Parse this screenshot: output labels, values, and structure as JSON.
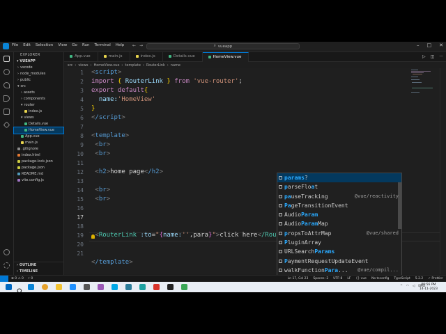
{
  "titlebar": {
    "menu": [
      "File",
      "Edit",
      "Selection",
      "View",
      "Go",
      "Run",
      "Terminal",
      "Help"
    ],
    "command_center": "vueapp"
  },
  "sidebar": {
    "header": "EXPLORER",
    "project": "VUEAPP",
    "items": [
      {
        "label": "vscode",
        "indent": 1,
        "icon_color": "#c5c5c5",
        "kind": "folder"
      },
      {
        "label": "node_modules",
        "indent": 1,
        "icon_color": "#c5c5c5",
        "kind": "folder"
      },
      {
        "label": "public",
        "indent": 1,
        "icon_color": "#c5c5c5",
        "kind": "folder"
      },
      {
        "label": "src",
        "indent": 1,
        "icon_color": "#c5c5c5",
        "kind": "folder-open"
      },
      {
        "label": "assets",
        "indent": 2,
        "icon_color": "#c5c5c5",
        "kind": "folder"
      },
      {
        "label": "components",
        "indent": 2,
        "icon_color": "#c5c5c5",
        "kind": "folder"
      },
      {
        "label": "router",
        "indent": 2,
        "icon_color": "#c5c5c5",
        "kind": "folder-open"
      },
      {
        "label": "index.js",
        "indent": 3,
        "icon_color": "#e8d44d",
        "kind": "file"
      },
      {
        "label": "views",
        "indent": 2,
        "icon_color": "#c5c5c5",
        "kind": "folder-open"
      },
      {
        "label": "Details.vue",
        "indent": 3,
        "icon_color": "#41b883",
        "kind": "file"
      },
      {
        "label": "HomeView.vue",
        "indent": 3,
        "icon_color": "#41b883",
        "kind": "file",
        "selected": true
      },
      {
        "label": "App.vue",
        "indent": 2,
        "icon_color": "#41b883",
        "kind": "file"
      },
      {
        "label": "main.js",
        "indent": 2,
        "icon_color": "#e8d44d",
        "kind": "file"
      },
      {
        "label": ".gitignore",
        "indent": 1,
        "icon_color": "#8a8a8a",
        "kind": "file"
      },
      {
        "label": "index.html",
        "indent": 1,
        "icon_color": "#e37933",
        "kind": "file"
      },
      {
        "label": "package-lock.json",
        "indent": 1,
        "icon_color": "#cbcb41",
        "kind": "file"
      },
      {
        "label": "package.json",
        "indent": 1,
        "icon_color": "#cbcb41",
        "kind": "file"
      },
      {
        "label": "README.md",
        "indent": 1,
        "icon_color": "#519aba",
        "kind": "file"
      },
      {
        "label": "vite.config.js",
        "indent": 1,
        "icon_color": "#a074c4",
        "kind": "file"
      }
    ],
    "outline": "OUTLINE",
    "timeline": "TIMELINE"
  },
  "tabs": [
    {
      "label": "App.vue",
      "icon_color": "#41b883"
    },
    {
      "label": "main.js",
      "icon_color": "#e8d44d"
    },
    {
      "label": "index.js",
      "icon_color": "#e8d44d"
    },
    {
      "label": "Details.vue",
      "icon_color": "#41b883"
    },
    {
      "label": "HomeView.vue",
      "icon_color": "#41b883",
      "active": true
    }
  ],
  "breadcrumb": [
    "src",
    "views",
    "HomeView.vue",
    "template",
    "RouterLink",
    "name"
  ],
  "editor": {
    "line_numbers": [
      "1",
      "2",
      "3",
      "4",
      "5",
      "6",
      "7",
      "8",
      "9",
      "10",
      "11",
      "12",
      "13",
      "14",
      "15",
      "16",
      "17",
      "18",
      "19",
      "20",
      "21"
    ],
    "current_line": "17",
    "code": {
      "l1_tag": "script",
      "l2_import": "import",
      "l2_name": "RouterLink",
      "l2_from": "from",
      "l2_mod": "'vue-router'",
      "l3_export": "export default",
      "l4_key": "name:",
      "l4_val": "'HomeView'",
      "l6_tag": "/script",
      "l8_tag": "template",
      "l9_tag": "br",
      "l10_tag": "br",
      "l12_open": "h2",
      "l12_text": "home page",
      "l12_close": "/h2",
      "l14_tag": "br",
      "l15_tag": "br",
      "l17_comp": "RouterLink",
      "l17_attr": ":to",
      "l17_name": "name:",
      "l17_q": "''",
      "l17_para": ",para",
      "l17_text": "click here",
      "l17_close": "/RouterLink",
      "l20_tag": "/template"
    }
  },
  "suggestions": [
    {
      "pre": "",
      "match": "params",
      "post": "?",
      "detail": "",
      "selected": true
    },
    {
      "pre": "",
      "match": "p",
      "post": "arseFlo",
      "match2": "a",
      "post2": "t",
      "detail": ""
    },
    {
      "pre": "",
      "match": "pa",
      "post": "useTracking",
      "detail": "@vue/reactivity"
    },
    {
      "pre": "",
      "match": "Pa",
      "post": "geTransitionEvent",
      "detail": ""
    },
    {
      "pre": "Audio",
      "match": "Param",
      "post": "",
      "detail": ""
    },
    {
      "pre": "Audio",
      "match": "Param",
      "post": "Map",
      "detail": ""
    },
    {
      "pre": "",
      "match": "p",
      "post": "ropsToAttrMap",
      "detail": "@vue/shared"
    },
    {
      "pre": "",
      "match": "P",
      "post": "luginArray",
      "detail": ""
    },
    {
      "pre": "URLSearch",
      "match": "Params",
      "post": "",
      "detail": ""
    },
    {
      "pre": "",
      "match": "P",
      "post": "aymentRequestUpdateEvent",
      "detail": ""
    },
    {
      "pre": "walkFunction",
      "match": "Para",
      "post": "...",
      "detail": "@vue/compil..."
    },
    {
      "pre": "createForLoop",
      "match": "Para",
      "post": "...",
      "detail": "@vue/compil..."
    }
  ],
  "statusbar": {
    "left": [
      "⊗ 0 ⚠ 0",
      "⚡ 0"
    ],
    "right": [
      "Ln 17, Col 23",
      "Spaces: 2",
      "UTF-8",
      "LF",
      "{} vue",
      "No tsconfig",
      "TypeScript",
      "5.2.2",
      "✓ Prettier"
    ]
  },
  "taskbar": {
    "apps": [
      {
        "name": "start",
        "color": "#0067c0"
      },
      {
        "name": "vscode",
        "color": "#0a84d6"
      },
      {
        "name": "chrome",
        "color": "#e5a12b"
      },
      {
        "name": "file-explorer",
        "color": "#f1c232"
      },
      {
        "name": "photos",
        "color": "#1e90ff"
      },
      {
        "name": "settings",
        "color": "#555555"
      },
      {
        "name": "media",
        "color": "#9b59b6"
      },
      {
        "name": "skype",
        "color": "#00a8e6"
      },
      {
        "name": "store",
        "color": "#2d7d9a"
      },
      {
        "name": "edge",
        "color": "#1ea3a3"
      },
      {
        "name": "app-red",
        "color": "#d9342b"
      },
      {
        "name": "app-dark",
        "color": "#222222"
      },
      {
        "name": "app-green",
        "color": "#3aa757"
      }
    ],
    "lang": "ENG",
    "time": "09:56 PM",
    "date": "14-11-2023"
  }
}
